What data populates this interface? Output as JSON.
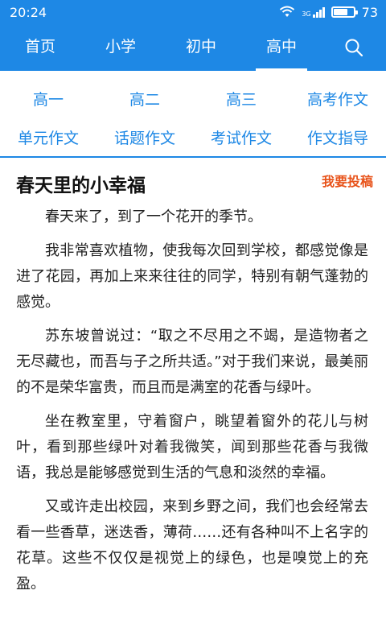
{
  "status_bar": {
    "time": "20:24",
    "signal_label": "3G",
    "battery": "73",
    "battery_level": 0.73
  },
  "nav": {
    "tabs": [
      {
        "label": "首页"
      },
      {
        "label": "小学"
      },
      {
        "label": "初中"
      },
      {
        "label": "高中",
        "active": true
      }
    ],
    "search_icon": "search-icon"
  },
  "categories": [
    "高一",
    "高二",
    "高三",
    "高考作文",
    "单元作文",
    "话题作文",
    "考试作文",
    "作文指导"
  ],
  "article": {
    "title": "春天里的小幸福",
    "submit_label": "我要投稿",
    "paragraphs": [
      "春天来了，到了一个花开的季节。",
      "我非常喜欢植物，使我每次回到学校，都感觉像是进了花园，再加上来来往往的同学，特别有朝气蓬勃的感觉。",
      "苏东坡曾说过：“取之不尽用之不竭，是造物者之无尽藏也，而吾与子之所共适。”对于我们来说，最美丽的不是荣华富贵，而且而是满室的花香与绿叶。",
      "坐在教室里，守着窗户，眺望着窗外的花儿与树叶，看到那些绿叶对着我微笑，闻到那些花香与我微语，我总是能够感觉到生活的气息和淡然的幸福。",
      "又或许走出校园，来到乡野之间，我们也会经常去看一些香草，迷迭香，薄荷……还有各种叫不上名字的花草。这些不仅仅是视觉上的绿色，也是嗅觉上的充盈。"
    ]
  },
  "colors": {
    "primary": "#1e88e5",
    "accent": "#e8531a"
  }
}
